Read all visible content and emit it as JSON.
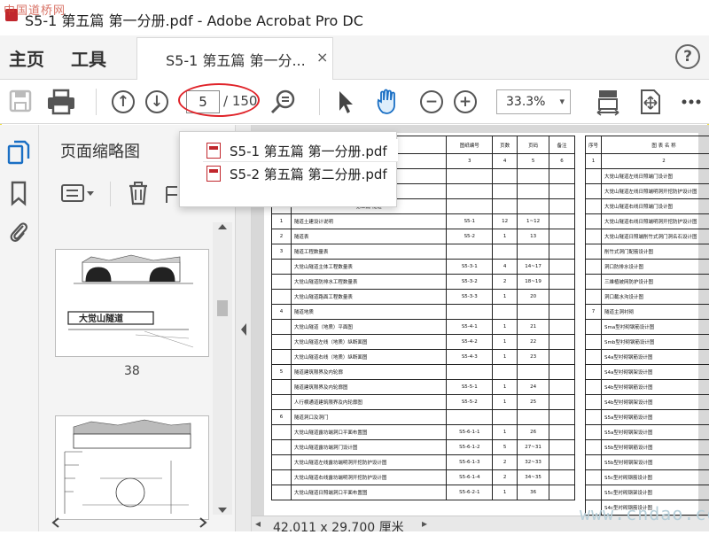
{
  "window": {
    "title": "S5-1 第五篇 第一分册.pdf - Adobe Acrobat Pro DC",
    "watermark_top": "中国道桥网"
  },
  "menubar": {
    "home": "主页",
    "tools": "工具",
    "doc_tab": "S5-1 第五篇 第一分...",
    "close": "×",
    "help": "?"
  },
  "toolbar": {
    "current_page": "5",
    "total_pages": "/ 150",
    "zoom": "33.3%",
    "zoom_chevron": "▾"
  },
  "sidebar": {
    "panel_title": "页面缩略图",
    "thumb_page_label": "38"
  },
  "recent_docs": [
    "S5-1 第五篇 第一分册.pdf",
    "S5-2 第五篇 第二分册.pdf"
  ],
  "document": {
    "page_size": "42.011 x 29.700 厘米",
    "watermark": "www.cndao.com",
    "left_table": {
      "headers": [
        "",
        "",
        "图纸编号",
        "页数",
        "页码",
        "备注"
      ],
      "numbers": [
        "",
        "",
        "3",
        "4",
        "5",
        "6"
      ],
      "section": "第五篇 隧道",
      "rows": [
        [
          "1",
          "隧道土建设计说明",
          "S5-1",
          "12",
          "1~12",
          ""
        ],
        [
          "2",
          "隧道表",
          "S5-2",
          "1",
          "13",
          ""
        ],
        [
          "3",
          "隧道工程数量表",
          "",
          "",
          "",
          ""
        ],
        [
          "",
          "大觉山隧道主体工程数量表",
          "S5-3-1",
          "4",
          "14~17",
          ""
        ],
        [
          "",
          "大觉山隧道防排水工程数量表",
          "S5-3-2",
          "2",
          "18~19",
          ""
        ],
        [
          "",
          "大觉山隧道路面工程数量表",
          "S5-3-3",
          "1",
          "20",
          ""
        ],
        [
          "4",
          "隧道地质",
          "",
          "",
          "",
          ""
        ],
        [
          "",
          "大觉山隧道（地质）平面图",
          "S5-4-1",
          "1",
          "21",
          ""
        ],
        [
          "",
          "大觉山隧道左线（地质）纵断面图",
          "S5-4-2",
          "1",
          "22",
          ""
        ],
        [
          "",
          "大觉山隧道右线（地质）纵断面图",
          "S5-4-3",
          "1",
          "23",
          ""
        ],
        [
          "5",
          "隧道建筑限界及内轮廓",
          "",
          "",
          "",
          ""
        ],
        [
          "",
          "隧道建筑限界及内轮廓图",
          "S5-5-1",
          "1",
          "24",
          ""
        ],
        [
          "",
          "人行横通道建筑限界及内轮廓图",
          "S5-5-2",
          "1",
          "25",
          ""
        ],
        [
          "6",
          "隧道洞口及洞门",
          "",
          "",
          "",
          ""
        ],
        [
          "",
          "大觉山隧道露坊端洞口平面布置图",
          "S5-6-1-1",
          "1",
          "26",
          ""
        ],
        [
          "",
          "大觉山隧道露坊端洞门设计图",
          "S5-6-1-2",
          "5",
          "27~31",
          ""
        ],
        [
          "",
          "大觉山隧道左线露坊端明洞开挖防护设计图",
          "S5-6-1-3",
          "2",
          "32~33",
          ""
        ],
        [
          "",
          "大觉山隧道右线露坊端明洞开挖防护设计图",
          "S5-6-1-4",
          "2",
          "34~35",
          ""
        ],
        [
          "",
          "大觉山隧道日照端洞口平面布置图",
          "S5-6-2-1",
          "1",
          "36",
          ""
        ]
      ]
    },
    "right_table": {
      "headers": [
        "序号",
        "图 表 名 称"
      ],
      "numbers": [
        "1",
        "2"
      ],
      "rows": [
        [
          "",
          "大觉山隧道左线日照端门设计图"
        ],
        [
          "",
          "大觉山隧道左线日照端明洞开挖防护设计图"
        ],
        [
          "",
          "大觉山隧道右线日照端门设计图"
        ],
        [
          "",
          "大觉山隧道右线日照端明洞开挖防护设计图"
        ],
        [
          "",
          "大觉山隧道日照端削竹式洞门洞名石设计图"
        ],
        [
          "",
          "削竹式洞门配筋设计图"
        ],
        [
          "",
          "洞口防排水设计图"
        ],
        [
          "",
          "三維植被网防护设计图"
        ],
        [
          "",
          "洞口截水沟设计图"
        ],
        [
          "7",
          "隧道主洞衬砌"
        ],
        [
          "",
          "Sma型衬砌钢筋设计图"
        ],
        [
          "",
          "Smb型衬砌钢筋设计图"
        ],
        [
          "",
          "S4a型衬砌钢筋设计图"
        ],
        [
          "",
          "S4a型衬砌钢架设计图"
        ],
        [
          "",
          "S4b型衬砌钢筋设计图"
        ],
        [
          "",
          "S4b型衬砌钢架设计图"
        ],
        [
          "",
          "S5a型衬砌钢筋设计图"
        ],
        [
          "",
          "S5a型衬砌钢架设计图"
        ],
        [
          "",
          "S5b型衬砌钢筋设计图"
        ],
        [
          "",
          "S5b型衬砌钢架设计图"
        ],
        [
          "",
          "S5c型衬砌钢筋设计图"
        ],
        [
          "",
          "S5c型衬砌钢架设计图"
        ],
        [
          "",
          "S4c型衬砌钢筋设计图"
        ]
      ]
    }
  },
  "colors": {
    "highlight": "#e0242a",
    "acrobat_red": "#c1272d",
    "sidebar_active": "#1a6fc4"
  }
}
